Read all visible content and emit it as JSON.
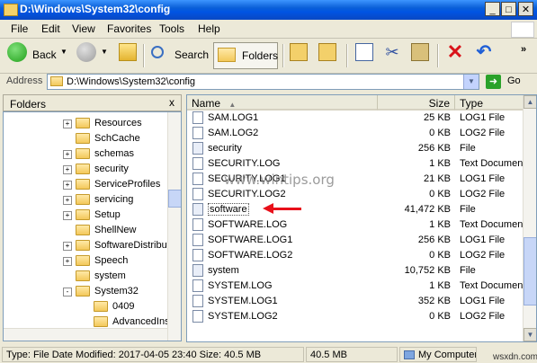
{
  "window": {
    "title": "D:\\Windows\\System32\\config"
  },
  "menu": [
    "File",
    "Edit",
    "View",
    "Favorites",
    "Tools",
    "Help"
  ],
  "toolbar": {
    "back": "Back",
    "search": "Search",
    "folders": "Folders"
  },
  "address": {
    "label": "Address",
    "value": "D:\\Windows\\System32\\config",
    "go": "Go"
  },
  "folders_pane": {
    "title": "Folders",
    "close": "x"
  },
  "tree": [
    {
      "label": "Resources",
      "expand": "+"
    },
    {
      "label": "SchCache",
      "expand": ""
    },
    {
      "label": "schemas",
      "expand": "+"
    },
    {
      "label": "security",
      "expand": "+"
    },
    {
      "label": "ServiceProfiles",
      "expand": "+"
    },
    {
      "label": "servicing",
      "expand": "+"
    },
    {
      "label": "Setup",
      "expand": "+"
    },
    {
      "label": "ShellNew",
      "expand": ""
    },
    {
      "label": "SoftwareDistribut",
      "expand": "+"
    },
    {
      "label": "Speech",
      "expand": "+"
    },
    {
      "label": "system",
      "expand": ""
    },
    {
      "label": "System32",
      "expand": "-"
    },
    {
      "label": "0409",
      "expand": ""
    },
    {
      "label": "AdvancedIns",
      "expand": ""
    }
  ],
  "columns": {
    "name": "Name",
    "size": "Size",
    "type": "Type"
  },
  "files": [
    {
      "name": "SAM.LOG1",
      "size": "25 KB",
      "type": "LOG1 File"
    },
    {
      "name": "SAM.LOG2",
      "size": "0 KB",
      "type": "LOG2 File"
    },
    {
      "name": "security",
      "size": "256 KB",
      "type": "File"
    },
    {
      "name": "SECURITY.LOG",
      "size": "1 KB",
      "type": "Text Documen"
    },
    {
      "name": "SECURITY.LOG1",
      "size": "21 KB",
      "type": "LOG1 File"
    },
    {
      "name": "SECURITY.LOG2",
      "size": "0 KB",
      "type": "LOG2 File"
    },
    {
      "name": "software",
      "size": "41,472 KB",
      "type": "File"
    },
    {
      "name": "SOFTWARE.LOG",
      "size": "1 KB",
      "type": "Text Documen"
    },
    {
      "name": "SOFTWARE.LOG1",
      "size": "256 KB",
      "type": "LOG1 File"
    },
    {
      "name": "SOFTWARE.LOG2",
      "size": "0 KB",
      "type": "LOG2 File"
    },
    {
      "name": "system",
      "size": "10,752 KB",
      "type": "File"
    },
    {
      "name": "SYSTEM.LOG",
      "size": "1 KB",
      "type": "Text Documen"
    },
    {
      "name": "SYSTEM.LOG1",
      "size": "352 KB",
      "type": "LOG1 File"
    },
    {
      "name": "SYSTEM.LOG2",
      "size": "0 KB",
      "type": "LOG2 File"
    }
  ],
  "status": {
    "info": "Type: File Date Modified: 2017-04-05 23:40 Size: 40.5 MB",
    "size": "40.5 MB",
    "location": "My Computer"
  },
  "watermarks": {
    "center": "www.wintips.org",
    "corner": "wsxdn.com"
  },
  "colors": {
    "title_bar": "#0054e3",
    "selection": "#316ac5",
    "arrow": "#e8101a"
  }
}
